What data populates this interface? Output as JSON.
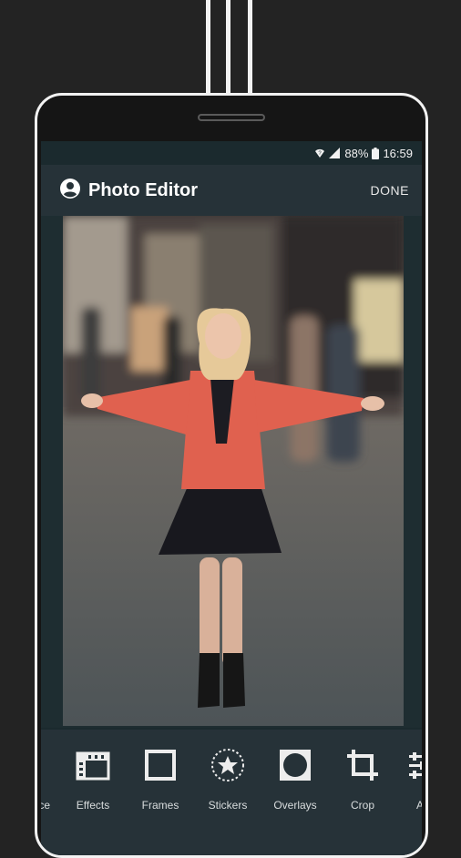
{
  "status_bar": {
    "battery": "88%",
    "time": "16:59"
  },
  "app_bar": {
    "title": "Photo Editor",
    "done_label": "DONE"
  },
  "toolbar": {
    "tools": [
      {
        "label": "ce",
        "icon": "partial-tool-icon"
      },
      {
        "label": "Effects",
        "icon": "film-strip-icon"
      },
      {
        "label": "Frames",
        "icon": "frame-icon"
      },
      {
        "label": "Stickers",
        "icon": "star-sticker-icon"
      },
      {
        "label": "Overlays",
        "icon": "circle-overlay-icon"
      },
      {
        "label": "Crop",
        "icon": "crop-icon"
      },
      {
        "label": "Ad",
        "icon": "adjust-sliders-icon"
      }
    ]
  },
  "colors": {
    "frame": "#f2f2f2",
    "background": "#232323",
    "app_bar": "#263238",
    "screen": "#1b2a2e",
    "jacket": "#e0614f"
  }
}
